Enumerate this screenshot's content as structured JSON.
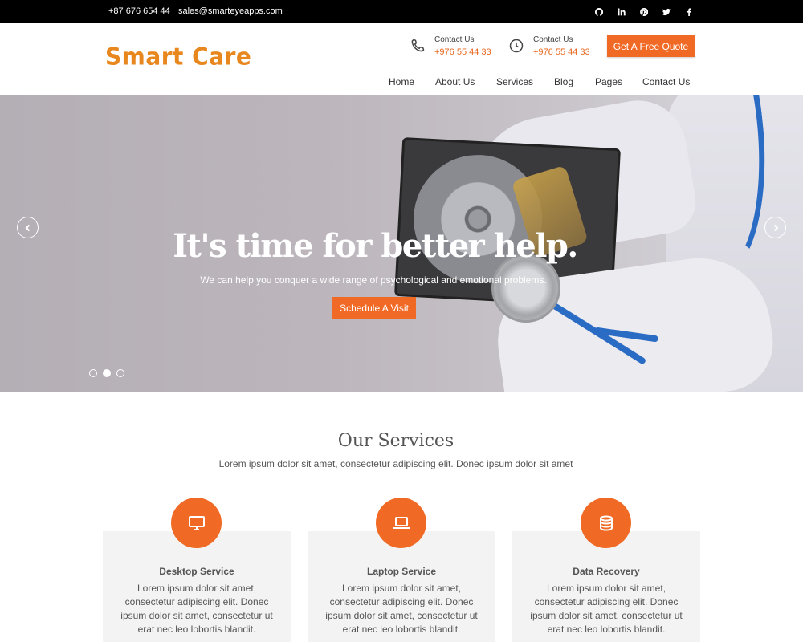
{
  "topbar": {
    "phone": "+87 676 654 44",
    "email": "sales@smarteyeapps.com",
    "social": [
      "github-icon",
      "linkedin-icon",
      "pinterest-icon",
      "twitter-icon",
      "facebook-icon"
    ]
  },
  "header": {
    "logo": "Smart Care",
    "contact1": {
      "label": "Contact Us",
      "value": "+976 55 44 33",
      "icon": "phone-icon"
    },
    "contact2": {
      "label": "Contact Us",
      "value": "+976 55 44 33",
      "icon": "clock-icon"
    },
    "quote_button": "Get A Free Quote"
  },
  "nav": [
    "Home",
    "About Us",
    "Services",
    "Blog",
    "Pages",
    "Contact Us"
  ],
  "hero": {
    "title": "It's time for better help.",
    "subtitle": "We can help you conquer a wide range of psychological and emotional problems.",
    "button": "Schedule A Visit",
    "slides": 3,
    "active_slide": 2
  },
  "services": {
    "title": "Our Services",
    "subtitle": "Lorem ipsum dolor sit amet, consectetur adipiscing elit. Donec ipsum dolor sit amet",
    "items": [
      {
        "icon": "desktop-icon",
        "title": "Desktop Service",
        "text": "Lorem ipsum dolor sit amet, consectetur adipiscing elit. Donec ipsum dolor sit amet, consectetur ut erat nec leo lobortis blandit."
      },
      {
        "icon": "laptop-icon",
        "title": "Laptop Service",
        "text": "Lorem ipsum dolor sit amet, consectetur adipiscing elit. Donec ipsum dolor sit amet, consectetur ut erat nec leo lobortis blandit."
      },
      {
        "icon": "database-icon",
        "title": "Data Recovery",
        "text": "Lorem ipsum dolor sit amet, consectetur adipiscing elit. Donec ipsum dolor sit amet, consectetur ut erat nec leo lobortis blandit."
      }
    ]
  },
  "colors": {
    "accent": "#f06a25",
    "logo": "#e8871e",
    "topbar": "#000000"
  }
}
